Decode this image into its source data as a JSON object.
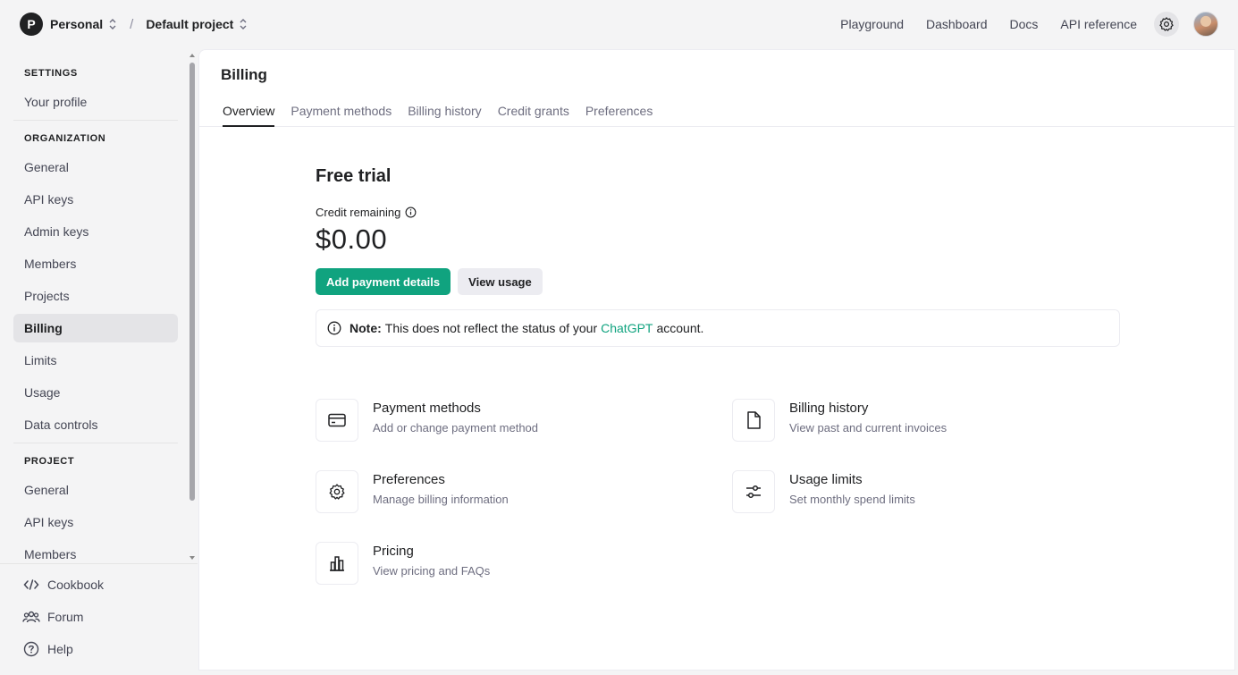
{
  "topbar": {
    "org_initial": "P",
    "org_name": "Personal",
    "separator": "/",
    "project_name": "Default project",
    "nav": [
      "Playground",
      "Dashboard",
      "Docs",
      "API reference"
    ]
  },
  "sidebar": {
    "settings_title": "SETTINGS",
    "settings_items": [
      "Your profile"
    ],
    "organization_title": "ORGANIZATION",
    "organization_items": [
      "General",
      "API keys",
      "Admin keys",
      "Members",
      "Projects",
      "Billing",
      "Limits",
      "Usage",
      "Data controls"
    ],
    "active_item": "Billing",
    "project_title": "PROJECT",
    "project_items": [
      "General",
      "API keys",
      "Members"
    ],
    "bottom": {
      "cookbook": "Cookbook",
      "forum": "Forum",
      "help": "Help"
    }
  },
  "main": {
    "title": "Billing",
    "tabs": [
      "Overview",
      "Payment methods",
      "Billing history",
      "Credit grants",
      "Preferences"
    ],
    "active_tab": "Overview",
    "plan_title": "Free trial",
    "credit_label": "Credit remaining",
    "credit_amount": "$0.00",
    "add_payment_label": "Add payment details",
    "view_usage_label": "View usage",
    "note": {
      "label": "Note:",
      "text_before": "This does not reflect the status of your",
      "link": "ChatGPT",
      "text_after": "account."
    },
    "cards": {
      "payment": {
        "title": "Payment methods",
        "desc": "Add or change payment method",
        "icon": "credit-card-icon"
      },
      "history": {
        "title": "Billing history",
        "desc": "View past and current invoices",
        "icon": "document-icon"
      },
      "preferences": {
        "title": "Preferences",
        "desc": "Manage billing information",
        "icon": "gear-icon"
      },
      "limits": {
        "title": "Usage limits",
        "desc": "Set monthly spend limits",
        "icon": "sliders-icon"
      },
      "pricing": {
        "title": "Pricing",
        "desc": "View pricing and FAQs",
        "icon": "bar-chart-icon"
      }
    }
  },
  "colors": {
    "accent": "#10a37f",
    "active_bg": "#e4e4e7",
    "page_bg": "#f4f4f5"
  }
}
